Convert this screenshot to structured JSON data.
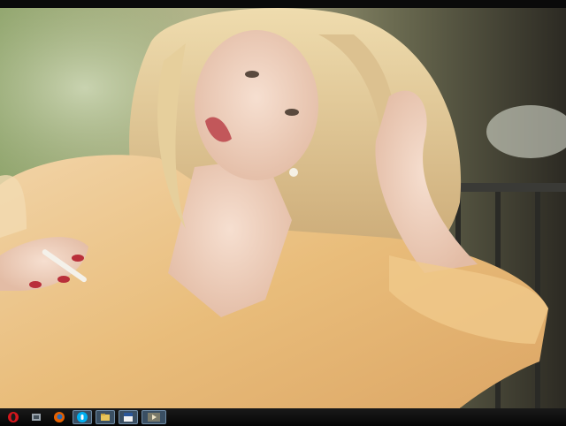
{
  "screen": {
    "content": "video-frame"
  },
  "taskbar": {
    "buttons": [
      {
        "name": "opera-browser-icon",
        "active": false
      },
      {
        "name": "system-tool-icon",
        "active": false
      },
      {
        "name": "firefox-icon",
        "active": false
      },
      {
        "name": "skype-icon",
        "active": true
      },
      {
        "name": "file-manager-icon",
        "active": true
      },
      {
        "name": "word-document-icon",
        "active": true
      },
      {
        "name": "media-player-icon",
        "active": true
      }
    ]
  },
  "colors": {
    "taskbar": "#0a0a0a",
    "active_button": "#3a4f63"
  }
}
